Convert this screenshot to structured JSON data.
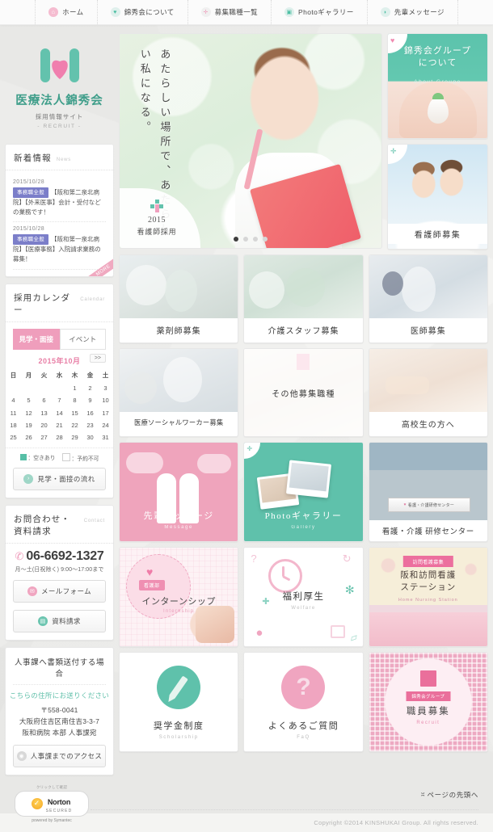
{
  "nav": {
    "items": [
      {
        "label": "ホーム",
        "icon": "home-icon"
      },
      {
        "label": "錦秀会について",
        "icon": "heart-icon"
      },
      {
        "label": "募集職種一覧",
        "icon": "cross-icon"
      },
      {
        "label": "Photoギャラリー",
        "icon": "camera-icon"
      },
      {
        "label": "先輩メッセージ",
        "icon": "speech-icon"
      }
    ]
  },
  "logo": {
    "name": "医療法人錦秀会",
    "sub": "採用情報サイト",
    "sub2": "- RECRUIT -"
  },
  "news": {
    "title_ja": "新着情報",
    "title_en": "News",
    "more": "MORE",
    "items": [
      {
        "date": "2015/10/28",
        "tag": "事務職全般",
        "text": "【阪和第二泉北病院】【外来医事】会計・受付などの業務です！"
      },
      {
        "date": "2015/10/28",
        "tag": "事務職全般",
        "text": "【阪和第一泉北病院】【医療事務】入院請求業務の募集！"
      }
    ]
  },
  "calendar": {
    "title_ja": "採用カレンダー",
    "title_en": "Calendar",
    "tabs": [
      {
        "label": "見学・面接",
        "active": true
      },
      {
        "label": "イベント",
        "active": false
      }
    ],
    "month": "2015年10月",
    "next": ">>",
    "weekdays": [
      "日",
      "月",
      "火",
      "水",
      "木",
      "金",
      "土"
    ],
    "weeks": [
      [
        "",
        "",
        "",
        "",
        "1",
        "2",
        "3"
      ],
      [
        "4",
        "5",
        "6",
        "7",
        "8",
        "9",
        "10"
      ],
      [
        "11",
        "12",
        "13",
        "14",
        "15",
        "16",
        "17"
      ],
      [
        "18",
        "19",
        "20",
        "21",
        "22",
        "23",
        "24"
      ],
      [
        "25",
        "26",
        "27",
        "28",
        "29",
        "30",
        "31"
      ]
    ],
    "legend_available": "：空きあり",
    "legend_unavailable": "：予約不可",
    "flow_button": "見学・面接の流れ"
  },
  "contact": {
    "title_ja": "お問合わせ・資料請求",
    "title_en": "Contact",
    "phone": "06-6692-1327",
    "hours": "月〜土(日祝除く) 9:00〜17:00まで",
    "mail_button": "メールフォーム",
    "docs_button": "資料請求"
  },
  "address": {
    "title": "人事課へ書類送付する場合",
    "lead": "こちらの住所にお送りください",
    "zip": "〒558-0041",
    "line1": "大阪府住吉区南住吉3-3-7",
    "line2": "阪和病院 本部 人事課宛",
    "access_button": "人事課までのアクセス"
  },
  "hero": {
    "copy": "あたらしい場所で、あたらしい私になる。",
    "badge_year": "2015",
    "badge_title": "看護師採用",
    "dots": 4,
    "active_dot": 0
  },
  "right_cards": [
    {
      "title": "錦秀会グループ\nについて",
      "title_line1": "錦秀会グループ",
      "title_line2": "について",
      "subtitle": "About Groupe",
      "style": "teal"
    },
    {
      "title": "看護師募集",
      "subtitle": "",
      "style": "photo"
    }
  ],
  "job_cards": [
    {
      "label": "薬剤師募集"
    },
    {
      "label": "介護スタッフ募集"
    },
    {
      "label": "医師募集"
    },
    {
      "label": "医療ソーシャルワーカー募集"
    },
    {
      "label": "その他募集職種"
    },
    {
      "label": "高校生の方へ"
    }
  ],
  "tiles_row1": [
    {
      "label": "先輩メッセージ",
      "sub": "Message",
      "style": "pink"
    },
    {
      "label": "Photoギャラリー",
      "sub": "Gallery",
      "style": "teal"
    },
    {
      "label": "看護・介護 研修センター",
      "sub": "",
      "style": "photo",
      "sign_text": "看護・介護研修センター"
    }
  ],
  "tiles_row2": [
    {
      "label": "インターンシップ",
      "sub": "Internship",
      "badge": "看護部",
      "style": "intern"
    },
    {
      "label": "福利厚生",
      "sub": "Welfare",
      "style": "welfare"
    },
    {
      "ribbon": "訪問看護募集",
      "label": "阪和訪問看護\nステーション",
      "label_line1": "阪和訪問看護",
      "label_line2": "ステーション",
      "sub": "Home Nursing Station",
      "style": "homenurse"
    }
  ],
  "tiles_row3": [
    {
      "label": "奨学金制度",
      "sub": "Scholarship",
      "style": "scholarship",
      "icon": "pencil-icon"
    },
    {
      "label": "よくあるご質問",
      "sub": "FaQ",
      "style": "faq",
      "icon": "question-icon"
    },
    {
      "pill": "錦秀会グループ",
      "label": "職員募集",
      "sub": "Recruit",
      "style": "recruit",
      "icon": "building-icon"
    }
  ],
  "footer": {
    "norton_tag": "クリックして確認",
    "norton_name": "Norton",
    "norton_secured": "SECURED",
    "norton_powered": "powered by Symantec",
    "to_top": "ページの先頭へ",
    "copyright": "Copyright ©2014 KINSHUKAI Group. All rights reserved."
  },
  "colors": {
    "teal": "#5fc1ab",
    "pink": "#efa4bc",
    "accent_pink": "#e87fa6",
    "tag_purple": "#7b7ec9"
  }
}
